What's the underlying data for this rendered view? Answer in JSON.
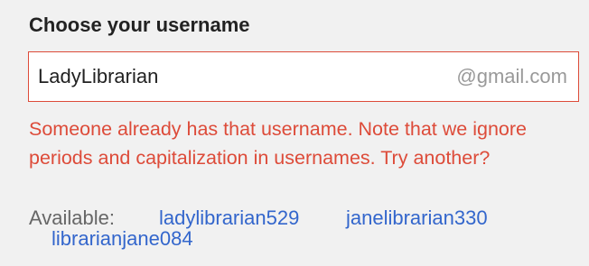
{
  "section": {
    "title": "Choose your username"
  },
  "username_field": {
    "value": "LadyLibrarian",
    "suffix": "@gmail.com"
  },
  "error": {
    "message": "Someone already has that username. Note that we ignore periods and capitalization in usernames. Try another?"
  },
  "suggestions": {
    "label": "Available:",
    "items": [
      "ladylibrarian529",
      "janelibrarian330",
      "librarianjane084"
    ]
  },
  "colors": {
    "error": "#dd4b39",
    "link": "#3366cc",
    "background": "#f1f1f1"
  }
}
